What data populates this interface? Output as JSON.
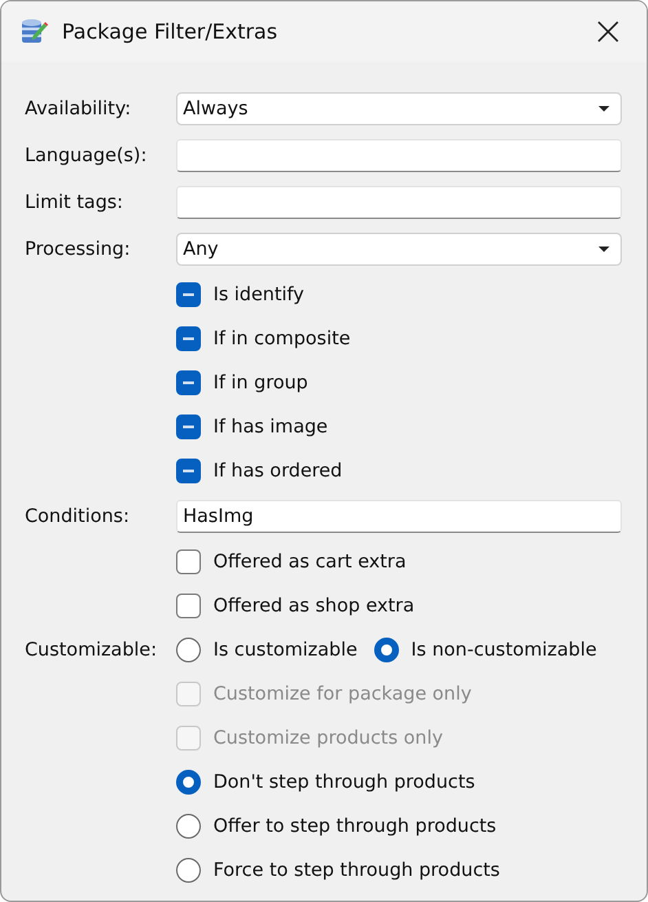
{
  "window": {
    "title": "Package Filter/Extras"
  },
  "rows": [
    {
      "kind": "dropdown",
      "label": "Availability:",
      "value": "Always"
    },
    {
      "kind": "text",
      "label": "Language(s):"
    },
    {
      "kind": "text",
      "label": "Limit tags:"
    },
    {
      "kind": "dropdown",
      "label": "Processing:",
      "value": "Any"
    },
    {
      "kind": "checkbox",
      "text": "Is identify",
      "indeterminate": true,
      "disabled": false
    },
    {
      "kind": "checkbox",
      "text": "If in composite",
      "indeterminate": true,
      "disabled": false
    },
    {
      "kind": "checkbox",
      "text": "If in group",
      "indeterminate": true,
      "disabled": false
    },
    {
      "kind": "checkbox",
      "text": "If has image",
      "indeterminate": true,
      "disabled": false
    },
    {
      "kind": "checkbox",
      "text": "If has ordered",
      "indeterminate": true,
      "disabled": false
    },
    {
      "kind": "text",
      "label": "Conditions:",
      "value": "HasImg"
    },
    {
      "kind": "checkbox",
      "text": "Offered as cart extra",
      "checked": false,
      "disabled": false
    },
    {
      "kind": "checkbox",
      "text": "Offered as shop extra",
      "checked": false,
      "disabled": false
    },
    {
      "kind": "radio_group",
      "label": "Customizable:",
      "options": [
        {
          "text": "Is customizable",
          "selected": false
        },
        {
          "text": "Is non-customizable",
          "selected": true
        }
      ]
    },
    {
      "kind": "checkbox",
      "text": "Customize for package only",
      "checked": false,
      "disabled": true
    },
    {
      "kind": "checkbox",
      "text": "Customize products only",
      "checked": false,
      "disabled": true
    },
    {
      "kind": "radio",
      "text": "Don't step through products",
      "selected": true
    },
    {
      "kind": "radio",
      "text": "Offer to step through products",
      "selected": false
    },
    {
      "kind": "radio",
      "text": "Force to step through products",
      "selected": false
    }
  ]
}
